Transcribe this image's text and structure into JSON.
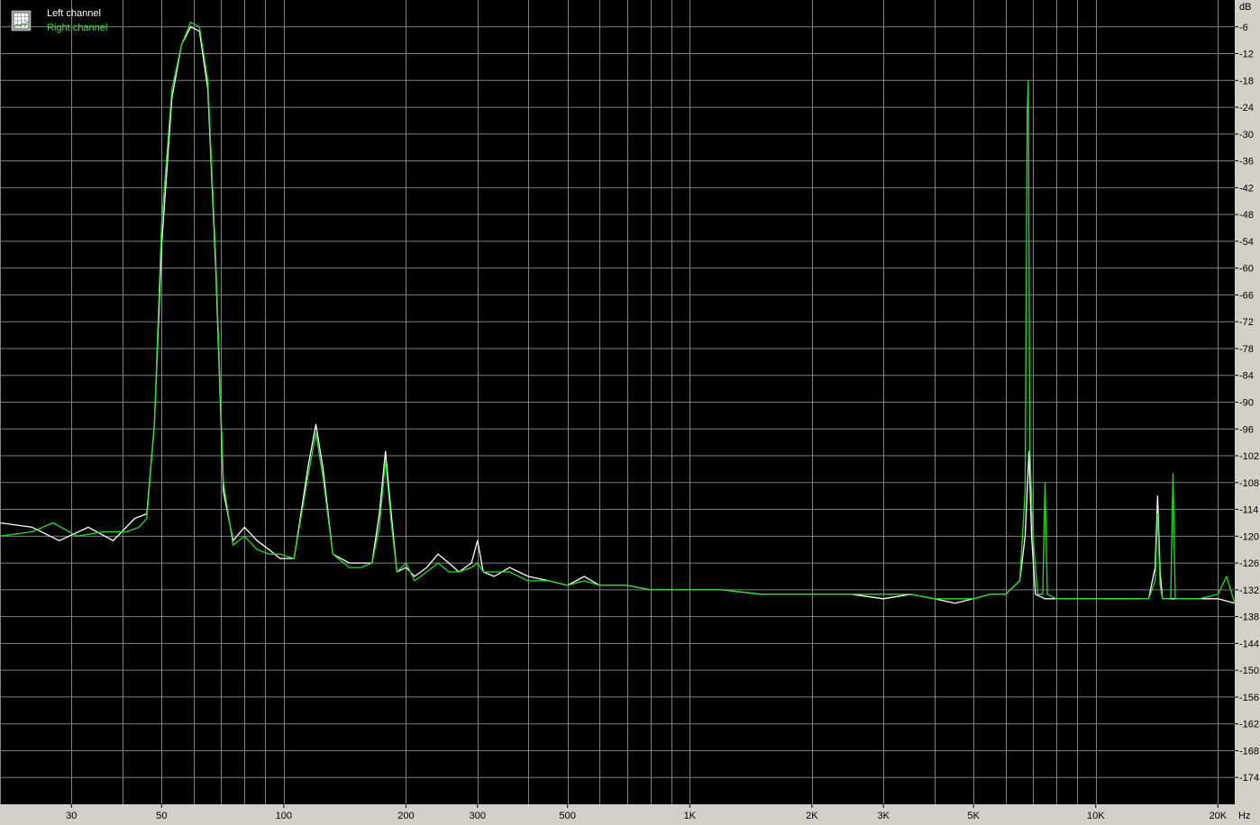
{
  "legend": {
    "icon": "spectrum-icon",
    "left_label": "Left channel",
    "right_label": "Right channel"
  },
  "colors": {
    "background": "#000000",
    "grid": "#808080",
    "frame": "#d4d0c8",
    "left": "#ffffff",
    "right": "#22dd22",
    "right_text": "#33ee33"
  },
  "chart_data": {
    "type": "line",
    "xscale": "log",
    "xunit": "Hz",
    "yunit": "dB",
    "xlim": [
      20,
      22000
    ],
    "ylim": [
      -180,
      0
    ],
    "grid": true,
    "legend_position": "top-left",
    "y_ticks": [
      -6,
      -12,
      -18,
      -24,
      -30,
      -36,
      -42,
      -48,
      -54,
      -60,
      -66,
      -72,
      -78,
      -84,
      -90,
      -96,
      -102,
      -108,
      -114,
      -120,
      -126,
      -132,
      -138,
      -144,
      -150,
      -156,
      -162,
      -168,
      -174
    ],
    "x_ticks": [
      {
        "value": 30,
        "label": "30"
      },
      {
        "value": 50,
        "label": "50"
      },
      {
        "value": 100,
        "label": "100"
      },
      {
        "value": 200,
        "label": "200"
      },
      {
        "value": 300,
        "label": "300"
      },
      {
        "value": 500,
        "label": "500"
      },
      {
        "value": 1000,
        "label": "1K"
      },
      {
        "value": 2000,
        "label": "2K"
      },
      {
        "value": 3000,
        "label": "3K"
      },
      {
        "value": 5000,
        "label": "5K"
      },
      {
        "value": 10000,
        "label": "10K"
      },
      {
        "value": 20000,
        "label": "20K"
      }
    ],
    "series": [
      {
        "name": "Left channel",
        "color": "#ffffff",
        "points": [
          [
            20,
            -117
          ],
          [
            24,
            -118
          ],
          [
            28,
            -121
          ],
          [
            33,
            -118
          ],
          [
            38,
            -121
          ],
          [
            43,
            -116
          ],
          [
            46,
            -115
          ],
          [
            48,
            -95
          ],
          [
            50,
            -55
          ],
          [
            53,
            -22
          ],
          [
            56,
            -10
          ],
          [
            59,
            -6
          ],
          [
            62,
            -7
          ],
          [
            65,
            -20
          ],
          [
            68,
            -60
          ],
          [
            71,
            -110
          ],
          [
            75,
            -121
          ],
          [
            80,
            -118
          ],
          [
            86,
            -121
          ],
          [
            92,
            -123
          ],
          [
            98,
            -125
          ],
          [
            106,
            -125
          ],
          [
            115,
            -104
          ],
          [
            120,
            -95
          ],
          [
            125,
            -105
          ],
          [
            132,
            -124
          ],
          [
            145,
            -126
          ],
          [
            155,
            -126
          ],
          [
            165,
            -126
          ],
          [
            172,
            -115
          ],
          [
            178,
            -101
          ],
          [
            184,
            -115
          ],
          [
            190,
            -128
          ],
          [
            200,
            -127
          ],
          [
            210,
            -129
          ],
          [
            225,
            -127
          ],
          [
            240,
            -124
          ],
          [
            255,
            -126
          ],
          [
            270,
            -128
          ],
          [
            290,
            -126
          ],
          [
            300,
            -121
          ],
          [
            310,
            -128
          ],
          [
            330,
            -129
          ],
          [
            360,
            -127
          ],
          [
            400,
            -129
          ],
          [
            450,
            -130
          ],
          [
            500,
            -131
          ],
          [
            550,
            -129
          ],
          [
            600,
            -131
          ],
          [
            700,
            -131
          ],
          [
            800,
            -132
          ],
          [
            900,
            -132
          ],
          [
            1000,
            -132
          ],
          [
            1200,
            -132
          ],
          [
            1500,
            -133
          ],
          [
            1800,
            -133
          ],
          [
            2000,
            -133
          ],
          [
            2500,
            -133
          ],
          [
            3000,
            -134
          ],
          [
            3500,
            -133
          ],
          [
            4000,
            -134
          ],
          [
            4500,
            -135
          ],
          [
            5000,
            -134
          ],
          [
            5500,
            -133
          ],
          [
            6000,
            -133
          ],
          [
            6500,
            -130
          ],
          [
            6700,
            -120
          ],
          [
            6850,
            -101
          ],
          [
            6950,
            -120
          ],
          [
            7100,
            -133
          ],
          [
            7500,
            -134
          ],
          [
            8000,
            -134
          ],
          [
            9000,
            -134
          ],
          [
            10000,
            -134
          ],
          [
            12000,
            -134
          ],
          [
            13500,
            -134
          ],
          [
            14000,
            -127
          ],
          [
            14200,
            -111
          ],
          [
            14400,
            -128
          ],
          [
            14600,
            -134
          ],
          [
            16000,
            -134
          ],
          [
            18000,
            -134
          ],
          [
            20000,
            -134
          ],
          [
            22000,
            -135
          ]
        ]
      },
      {
        "name": "Right channel",
        "color": "#22dd22",
        "points": [
          [
            20,
            -120
          ],
          [
            24,
            -119
          ],
          [
            27,
            -117
          ],
          [
            31,
            -120
          ],
          [
            36,
            -119
          ],
          [
            41,
            -119
          ],
          [
            44,
            -118
          ],
          [
            46,
            -116
          ],
          [
            48,
            -95
          ],
          [
            50,
            -50
          ],
          [
            53,
            -20
          ],
          [
            56,
            -10
          ],
          [
            59,
            -5
          ],
          [
            62,
            -6
          ],
          [
            65,
            -18
          ],
          [
            68,
            -58
          ],
          [
            71,
            -108
          ],
          [
            75,
            -122
          ],
          [
            80,
            -120
          ],
          [
            86,
            -123
          ],
          [
            92,
            -124
          ],
          [
            98,
            -124
          ],
          [
            106,
            -125
          ],
          [
            115,
            -106
          ],
          [
            120,
            -97
          ],
          [
            125,
            -107
          ],
          [
            132,
            -124
          ],
          [
            145,
            -127
          ],
          [
            155,
            -127
          ],
          [
            165,
            -126
          ],
          [
            172,
            -118
          ],
          [
            178,
            -103
          ],
          [
            184,
            -117
          ],
          [
            190,
            -128
          ],
          [
            200,
            -126
          ],
          [
            210,
            -130
          ],
          [
            225,
            -128
          ],
          [
            240,
            -126
          ],
          [
            255,
            -128
          ],
          [
            270,
            -128
          ],
          [
            290,
            -127
          ],
          [
            300,
            -126
          ],
          [
            310,
            -128
          ],
          [
            330,
            -128
          ],
          [
            360,
            -128
          ],
          [
            400,
            -130
          ],
          [
            450,
            -130
          ],
          [
            500,
            -131
          ],
          [
            550,
            -130
          ],
          [
            600,
            -131
          ],
          [
            700,
            -131
          ],
          [
            800,
            -132
          ],
          [
            900,
            -132
          ],
          [
            1000,
            -132
          ],
          [
            1200,
            -132
          ],
          [
            1500,
            -133
          ],
          [
            1800,
            -133
          ],
          [
            2000,
            -133
          ],
          [
            2500,
            -133
          ],
          [
            3000,
            -133
          ],
          [
            3500,
            -133
          ],
          [
            4000,
            -134
          ],
          [
            4500,
            -134
          ],
          [
            5000,
            -134
          ],
          [
            5500,
            -133
          ],
          [
            6000,
            -133
          ],
          [
            6500,
            -130
          ],
          [
            6700,
            -110
          ],
          [
            6780,
            -25
          ],
          [
            6820,
            -18
          ],
          [
            6880,
            -100
          ],
          [
            7000,
            -120
          ],
          [
            7200,
            -133
          ],
          [
            7400,
            -133
          ],
          [
            7500,
            -108
          ],
          [
            7600,
            -133
          ],
          [
            8000,
            -134
          ],
          [
            9000,
            -134
          ],
          [
            10000,
            -134
          ],
          [
            12000,
            -134
          ],
          [
            13500,
            -134
          ],
          [
            14000,
            -130
          ],
          [
            14200,
            -115
          ],
          [
            14400,
            -131
          ],
          [
            14600,
            -134
          ],
          [
            15300,
            -134
          ],
          [
            15500,
            -106
          ],
          [
            15700,
            -134
          ],
          [
            16000,
            -134
          ],
          [
            18000,
            -134
          ],
          [
            20000,
            -133
          ],
          [
            21000,
            -129
          ],
          [
            22000,
            -135
          ]
        ]
      }
    ]
  }
}
